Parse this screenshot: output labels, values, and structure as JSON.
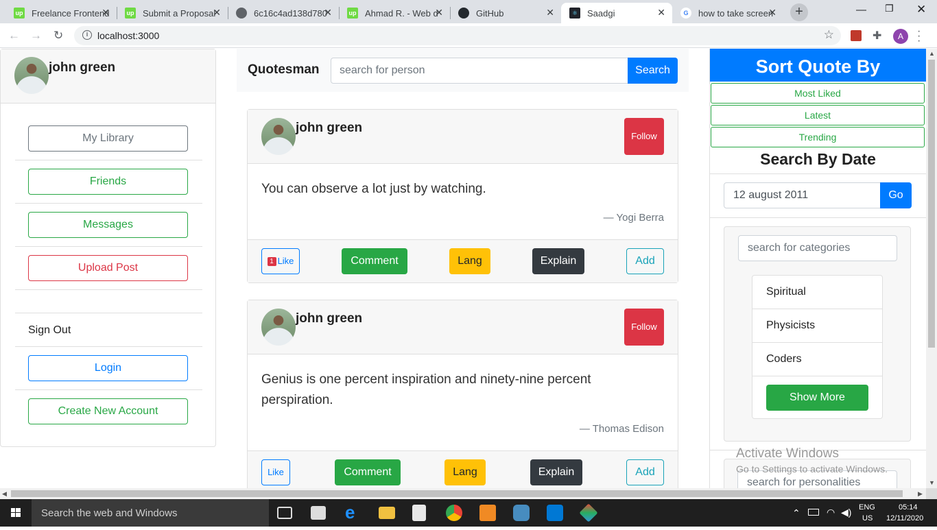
{
  "browser": {
    "tabs": [
      {
        "title": "Freelance Frontend",
        "favicon": "upwork-icon",
        "color": "#6fda44"
      },
      {
        "title": "Submit a Proposal",
        "favicon": "upwork-icon",
        "color": "#6fda44"
      },
      {
        "title": "6c16c4ad138d780",
        "favicon": "globe-icon",
        "color": "#5f6368"
      },
      {
        "title": "Ahmad R. - Web d",
        "favicon": "upwork-icon",
        "color": "#6fda44"
      },
      {
        "title": "GitHub",
        "favicon": "github-icon",
        "color": "#24292e"
      },
      {
        "title": "Saadgi",
        "favicon": "react-icon",
        "color": "#20232a"
      },
      {
        "title": "how to take screen",
        "favicon": "google-icon",
        "color": "#4285f4"
      }
    ],
    "active_tab": 5,
    "url": "localhost:3000",
    "account_initial": "A"
  },
  "sidebar": {
    "user_name": "john green",
    "buttons": {
      "library": "My Library",
      "friends": "Friends",
      "messages": "Messages",
      "upload": "Upload Post"
    },
    "sign_out": "Sign Out",
    "login": "Login",
    "create_account": "Create New Account"
  },
  "header": {
    "brand": "Quotesman",
    "search_placeholder": "search for person",
    "search_button": "Search"
  },
  "posts": [
    {
      "author": "john green",
      "follow": "Follow",
      "quote": "You can observe a lot just by watching.",
      "attribution": "— Yogi Berra",
      "like_count": "1",
      "like": "Like",
      "comment": "Comment",
      "lang": "Lang",
      "explain": "Explain",
      "add": "Add"
    },
    {
      "author": "john green",
      "follow": "Follow",
      "quote": "Genius is one percent inspiration and ninety-nine percent perspiration.",
      "attribution": "— Thomas Edison",
      "like": "Like",
      "comment": "Comment",
      "lang": "Lang",
      "explain": "Explain",
      "add": "Add"
    }
  ],
  "right_panel": {
    "title": "Sort Quote By",
    "sort_options": [
      "Most Liked",
      "Latest",
      "Trending"
    ],
    "date_title": "Search By Date",
    "date_value": "12 august 2011",
    "go": "Go",
    "category_placeholder": "search for categories",
    "categories": [
      "Spiritual",
      "Physicists",
      "Coders"
    ],
    "show_more": "Show More",
    "personality_placeholder": "search for personalities"
  },
  "watermark": {
    "line1": "Activate Windows",
    "line2": "Go to Settings to activate Windows."
  },
  "taskbar": {
    "search_text": "Search the web and Windows",
    "lang": "ENG",
    "region": "US",
    "time": "05:14",
    "date": "12/11/2020"
  }
}
